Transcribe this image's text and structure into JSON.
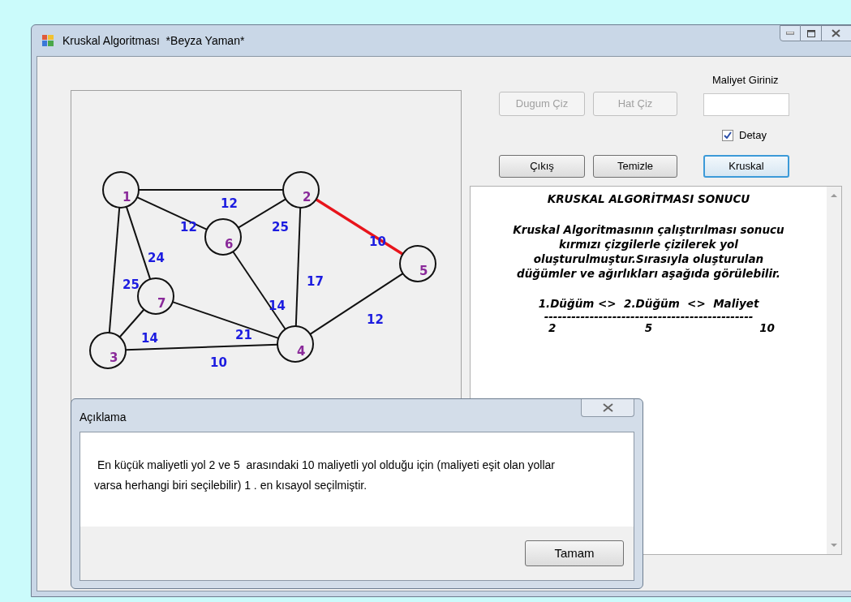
{
  "window": {
    "title": "Kruskal Algoritması  *Beyza Yaman*"
  },
  "graph": {
    "nodes": [
      {
        "label": "1"
      },
      {
        "label": "2"
      },
      {
        "label": "3"
      },
      {
        "label": "4"
      },
      {
        "label": "5"
      },
      {
        "label": "6"
      },
      {
        "label": "7"
      }
    ],
    "edges": [
      {
        "weight": "12",
        "selected": false
      },
      {
        "weight": "12",
        "selected": false
      },
      {
        "weight": "25",
        "selected": false
      },
      {
        "weight": "10",
        "selected": true
      },
      {
        "weight": "24",
        "selected": false
      },
      {
        "weight": "25",
        "selected": false
      },
      {
        "weight": "17",
        "selected": false
      },
      {
        "weight": "14",
        "selected": false
      },
      {
        "weight": "12",
        "selected": false
      },
      {
        "weight": "14",
        "selected": false
      },
      {
        "weight": "21",
        "selected": false
      },
      {
        "weight": "10",
        "selected": false
      }
    ]
  },
  "controls": {
    "draw_node_button": {
      "label": "Dugum Çiz",
      "disabled": true
    },
    "draw_edge_button": {
      "label": "Hat Çiz",
      "disabled": true
    },
    "cost_label": "Maliyet Giriniz",
    "detail_checkbox": {
      "label": "Detay",
      "checked": true
    },
    "exit_button": {
      "label": "Çıkış"
    },
    "clear_button": {
      "label": "Temizle"
    },
    "kruskal_button": {
      "label": "Kruskal",
      "focused": true
    }
  },
  "result": {
    "title": "KRUSKAL ALGORİTMASI SONUCU",
    "lines": [
      "Kruskal Algoritmasının çalıştırılması sonucu",
      "kırmızı çizgilerle çizilerek yol",
      "oluşturulmuştur.Sırasıyla oluşturulan",
      "düğümler ve ağırlıkları aşağıda görülebilir."
    ],
    "header": "1.Düğüm <>  2.Düğüm  <>  Maliyet",
    "separator": "----------------------------------------------",
    "rows": [
      [
        "2",
        "5",
        "10"
      ]
    ]
  },
  "dialog": {
    "title": "Açıklama",
    "message": " En küçük maliyetli yol 2 ve 5  arasındaki 10 maliyetli yol olduğu için (maliyeti eşit olan yollar varsa herhangi biri seçilebilir) 1 . en kısayol seçilmiştir.",
    "button": "Tamam"
  }
}
